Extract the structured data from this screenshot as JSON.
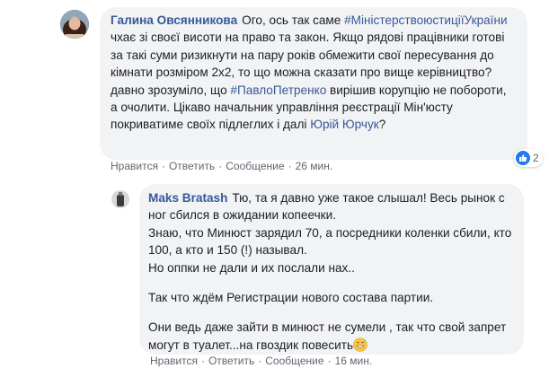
{
  "comments": [
    {
      "author": "Галина Овсянникова",
      "segments": [
        {
          "type": "text",
          "value": "Ого, ось так саме "
        },
        {
          "type": "tag",
          "value": "#МіністерствоюстиціїУкраїни"
        },
        {
          "type": "text",
          "value": " чхає зі своєї висоти на право та закон. Якщо рядові працівники готові за такі суми ризикнути на пару років обмежити свої пересування до кімнати розміром 2х2, то що можна сказати про вище керівництво? давно зрозуміло, що "
        },
        {
          "type": "tag",
          "value": "#ПавлоПетренко"
        },
        {
          "type": "text",
          "value": " вирішив корупцію не побороти, а очолити. Цікаво начальник управління реєстрації Мін'юсту покриватиме своїх підлеглих і далі "
        },
        {
          "type": "mention",
          "value": "Юрій Юрчук"
        },
        {
          "type": "text",
          "value": "?"
        }
      ],
      "actions": {
        "like": "Нравится",
        "reply": "Ответить",
        "message": "Сообщение",
        "time": "26 мин."
      },
      "reactions": {
        "icon": "thumbs-up-icon",
        "count": "2"
      }
    },
    {
      "author": "Maks Bratash",
      "paragraphs": [
        "Тю, та я давно уже такое слышал! Весь рынок с ног сбился в ожидании копеечки.\nЗнаю, что Минюст зарядил 70, а посредники коленки сбили, кто 100, а кто и 150 (!) называл.\nНо оппки не дали и их послали нах..",
        "Так что ждём Регистрации нового состава партии.",
        "Они ведь даже зайти в минюст не сумели , так что свой запрет могут в туалет...на гвоздик повесить"
      ],
      "trailing_emoji": "grinning-sweat-emoji",
      "actions": {
        "like": "Нравится",
        "reply": "Ответить",
        "message": "Сообщение",
        "time": "16 мин."
      }
    }
  ],
  "colors": {
    "link": "#385898",
    "bubble": "#f2f3f5",
    "meta": "#606770",
    "like": "#2078f4"
  }
}
